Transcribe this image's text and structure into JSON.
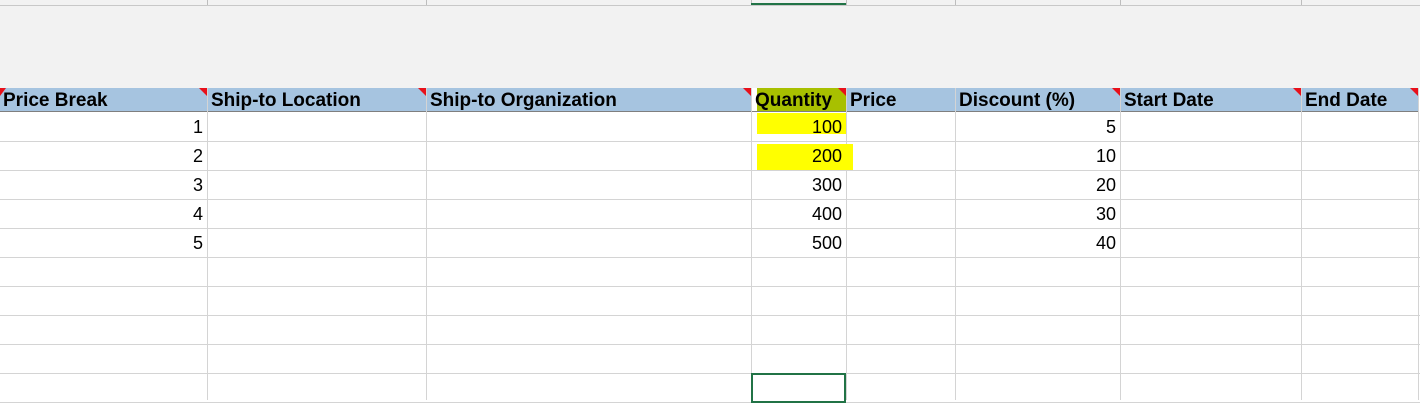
{
  "columns": [
    "Price Break",
    "Ship-to Location",
    "Ship-to Organization",
    "Quantity",
    "Price",
    "Discount (%)",
    "Start Date",
    "End Date"
  ],
  "rows": [
    {
      "price_break": "1",
      "quantity": "100",
      "discount": "5"
    },
    {
      "price_break": "2",
      "quantity": "200",
      "discount": "10"
    },
    {
      "price_break": "3",
      "quantity": "300",
      "discount": "20"
    },
    {
      "price_break": "4",
      "quantity": "400",
      "discount": "30"
    },
    {
      "price_break": "5",
      "quantity": "500",
      "discount": "40"
    }
  ],
  "colors": {
    "header_bg": "#a6c4e0",
    "highlight": "#ffff00",
    "comment_marker": "#e8101a",
    "selection": "#217346"
  }
}
